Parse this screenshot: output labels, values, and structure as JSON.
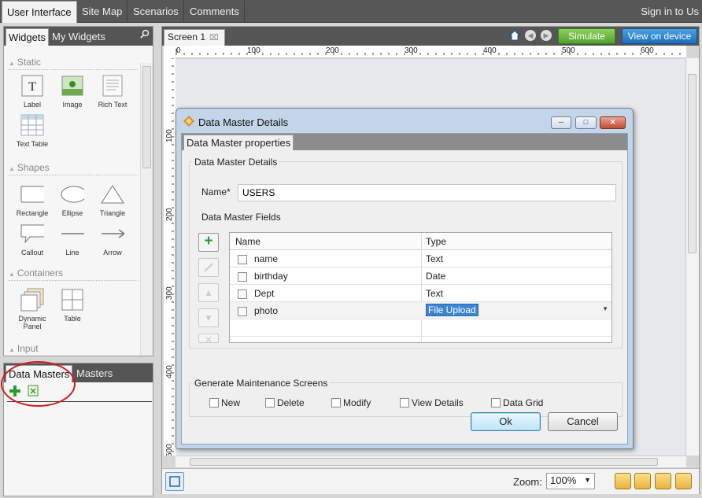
{
  "top_tabs": [
    "User Interface",
    "Site Map",
    "Scenarios",
    "Comments"
  ],
  "sign_in": "Sign in to Us",
  "widgets_panel": {
    "tabs": [
      "Widgets",
      "My Widgets"
    ],
    "sections": {
      "static": "Static",
      "shapes": "Shapes",
      "containers": "Containers",
      "input": "Input"
    },
    "items": {
      "label": "Label",
      "image": "Image",
      "rich_text": "Rich Text",
      "text_table": "Text Table",
      "rectangle": "Rectangle",
      "ellipse": "Ellipse",
      "triangle": "Triangle",
      "callout": "Callout",
      "line": "Line",
      "arrow": "Arrow",
      "dynamic_panel": "Dynamic Panel",
      "table": "Table"
    }
  },
  "masters_panel": {
    "tabs": [
      "Data Masters",
      "Masters"
    ]
  },
  "canvas": {
    "screen_tab": "Screen 1",
    "simulate": "Simulate",
    "view_on_device": "View on device",
    "ruler_h": [
      "0",
      "100",
      "200",
      "300",
      "400",
      "500",
      "600"
    ],
    "ruler_v": [
      "100",
      "200",
      "300",
      "400",
      "500"
    ],
    "zoom_label": "Zoom:",
    "zoom_value": "100%"
  },
  "dialog": {
    "title": "Data Master Details",
    "tab": "Data Master properties",
    "group_details": "Data Master Details",
    "name_label": "Name*",
    "name_value": "USERS",
    "fields_label": "Data Master Fields",
    "columns": [
      "Name",
      "Type"
    ],
    "rows": [
      {
        "name": "name",
        "type": "Text"
      },
      {
        "name": "birthday",
        "type": "Date"
      },
      {
        "name": "Dept",
        "type": "Text"
      },
      {
        "name": "photo",
        "type": "File Upload"
      }
    ],
    "group_generate": "Generate Maintenance Screens",
    "options": [
      "New",
      "Delete",
      "Modify",
      "View Details",
      "Data Grid"
    ],
    "ok": "Ok",
    "cancel": "Cancel"
  },
  "colors": {
    "annotation_circle": "#d21c1c",
    "simulate_green": "#51a22b",
    "view_device_blue": "#1a6fbb",
    "selection_blue": "#3b85d3"
  }
}
